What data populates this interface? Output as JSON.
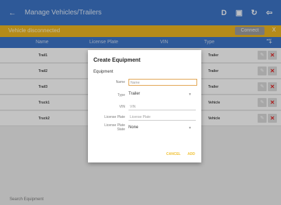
{
  "appbar": {
    "back_icon": "←",
    "title": "Manage Vehicles/Trailers",
    "icons": [
      "D",
      "▣",
      "↻",
      "⇦"
    ]
  },
  "status": {
    "message": "Vehicle disconnected",
    "connect_label": "Connect",
    "close_label": "X"
  },
  "table": {
    "columns": [
      "Name",
      "License Plate",
      "VIN",
      "Type"
    ],
    "add_label": "+",
    "add_sub": "add",
    "rows": [
      {
        "name": "Trail1",
        "type": "Trailer"
      },
      {
        "name": "Trail2",
        "type": "Trailer"
      },
      {
        "name": "Trail3",
        "type": "Trailer"
      },
      {
        "name": "Truck1",
        "type": "Vehicle"
      },
      {
        "name": "Truck2",
        "type": "Vehicle"
      }
    ],
    "edit_icon": "✎",
    "delete_icon": "✕"
  },
  "search": {
    "label": "Search Equipment"
  },
  "dialog": {
    "title": "Create Equipment",
    "section": "Equipment",
    "name_label": "Name",
    "name_placeholder": "Name",
    "type_label": "Type",
    "type_value": "Trailer",
    "vin_label": "VIN",
    "vin_placeholder": "VIN",
    "plate_label": "License Plate",
    "plate_placeholder": "License Plate",
    "state_label_1": "License Plate",
    "state_label_2": "State",
    "state_value": "None",
    "caret_icon": "▼",
    "cancel_label": "CANCEL",
    "add_label": "ADD"
  }
}
